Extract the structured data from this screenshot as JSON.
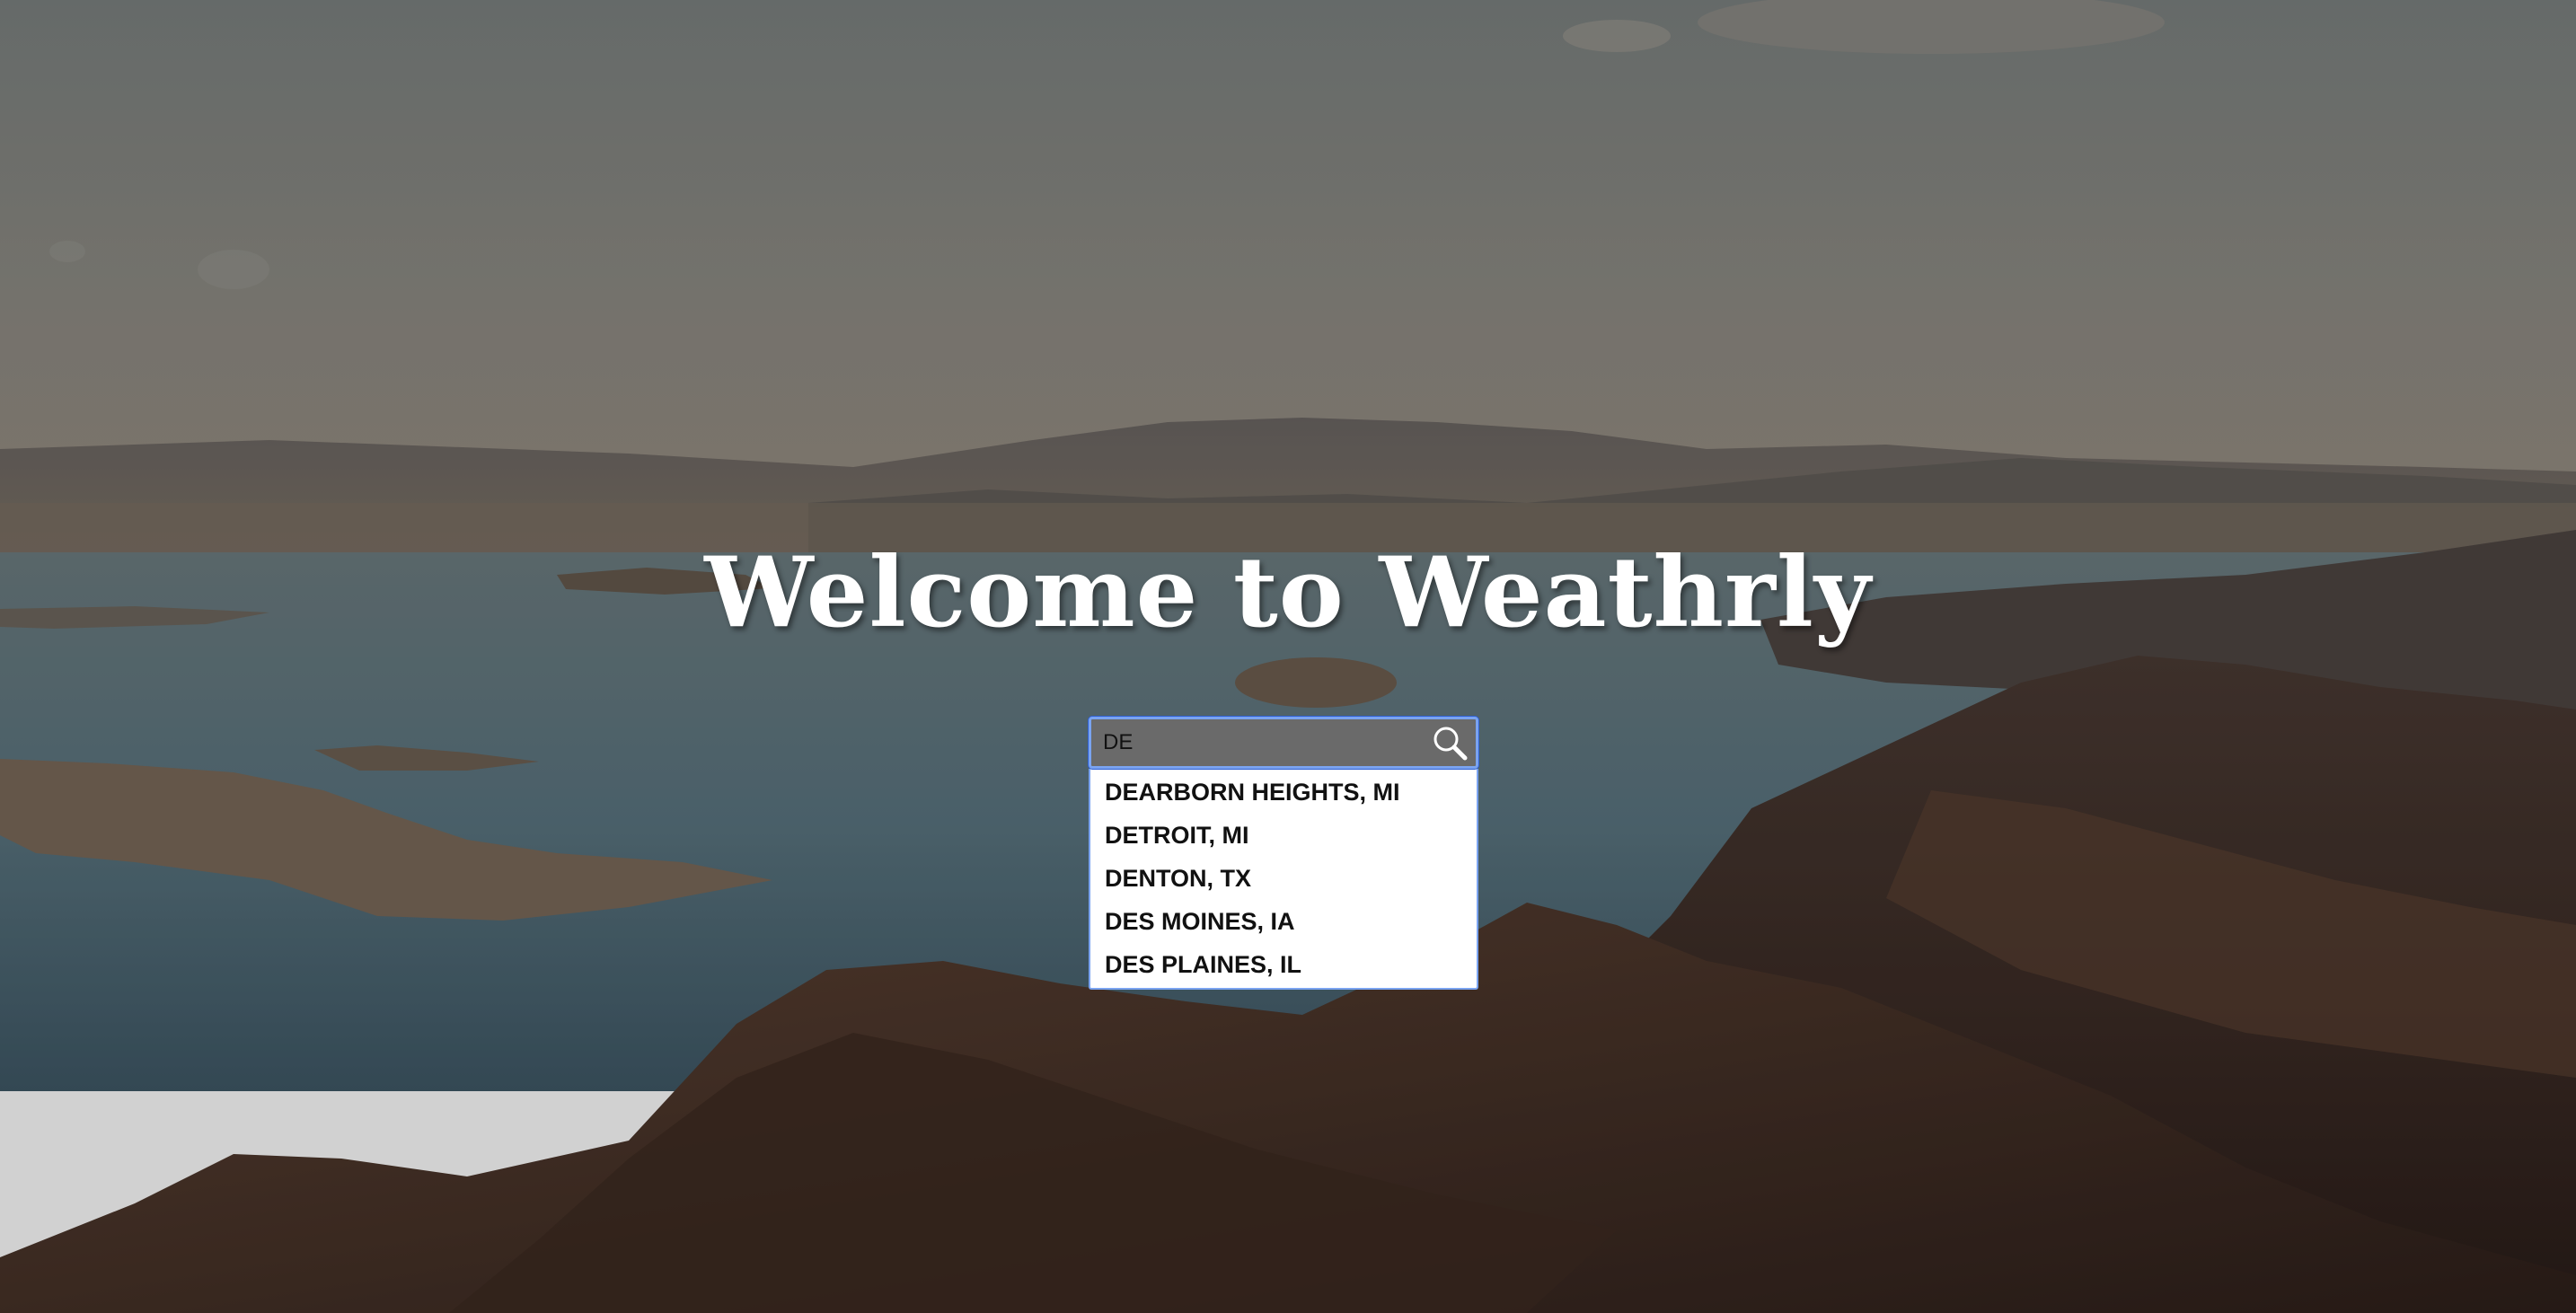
{
  "page": {
    "title": "Welcome to Weathrly"
  },
  "search": {
    "value": "DE",
    "placeholder": "",
    "button_icon": "search-icon"
  },
  "suggestions": [
    {
      "label": "DEARBORN HEIGHTS, MI"
    },
    {
      "label": "DETROIT, MI"
    },
    {
      "label": "DENTON, TX"
    },
    {
      "label": "DES MOINES, IA"
    },
    {
      "label": "DES PLAINES, IL"
    }
  ],
  "colors": {
    "focus_ring": "#7aa3f0",
    "title_text": "#ffffff",
    "input_background": "#6a6a6a"
  }
}
